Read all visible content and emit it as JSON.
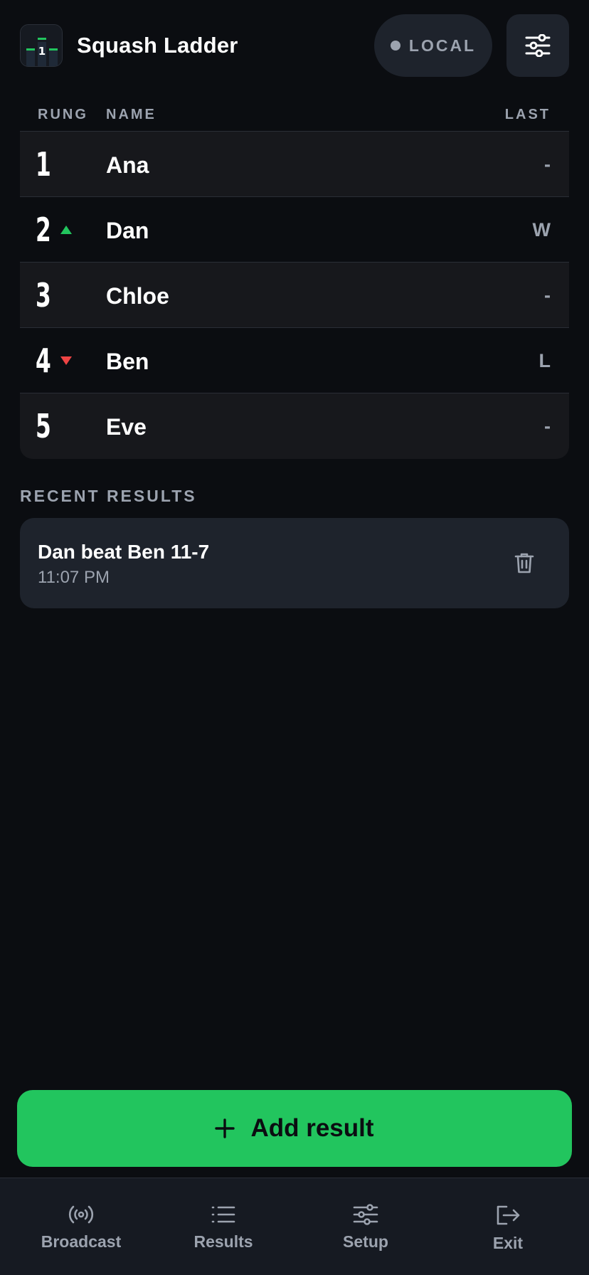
{
  "header": {
    "title": "Squash Ladder",
    "mode_label": "LOCAL",
    "logo_digit": "1"
  },
  "table": {
    "headers": {
      "rung": "RUNG",
      "name": "NAME",
      "last": "LAST"
    },
    "rows": [
      {
        "rung": "1",
        "name": "Ana",
        "last": "-",
        "movement": "none"
      },
      {
        "rung": "2",
        "name": "Dan",
        "last": "W",
        "movement": "up"
      },
      {
        "rung": "3",
        "name": "Chloe",
        "last": "-",
        "movement": "none"
      },
      {
        "rung": "4",
        "name": "Ben",
        "last": "L",
        "movement": "down"
      },
      {
        "rung": "5",
        "name": "Eve",
        "last": "-",
        "movement": "none"
      }
    ]
  },
  "recent": {
    "title": "RECENT RESULTS",
    "items": [
      {
        "text": "Dan beat Ben 11-7",
        "time": "11:07 PM"
      }
    ]
  },
  "add_button": {
    "label": "Add result"
  },
  "nav": {
    "items": [
      {
        "label": "Broadcast",
        "icon": "broadcast-icon"
      },
      {
        "label": "Results",
        "icon": "list-icon"
      },
      {
        "label": "Setup",
        "icon": "sliders-icon"
      },
      {
        "label": "Exit",
        "icon": "exit-icon"
      }
    ]
  },
  "colors": {
    "background": "#0b0d11",
    "accent": "#22c55e",
    "down": "#ef4444",
    "muted": "#9ca3af",
    "card": "#1e232c"
  }
}
